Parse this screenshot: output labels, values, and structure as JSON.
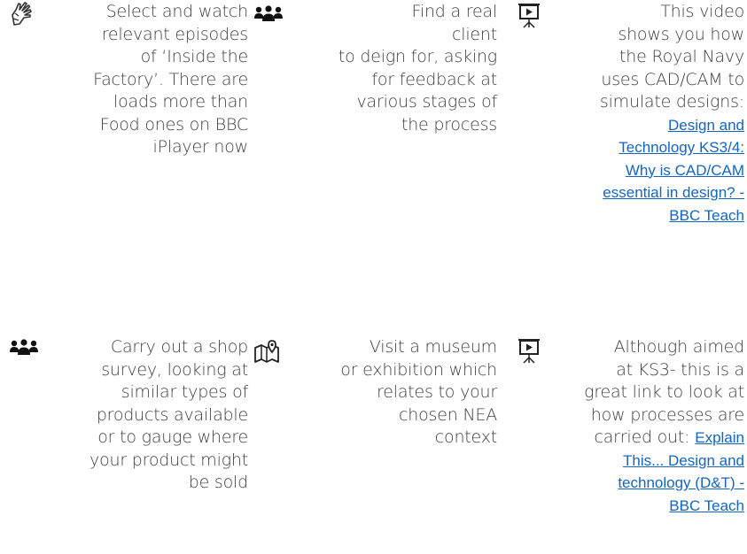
{
  "cells": [
    {
      "icon": "sign-language-hand-icon",
      "lines": [
        "Select and watch",
        "relevant episodes",
        "of ‘Inside the",
        "Factory’. There are",
        "loads more than",
        "Food ones on BBC",
        "iPlayer now"
      ]
    },
    {
      "icon": "people-group-icon",
      "lines": [
        "Find a real",
        "client",
        "to deign for, asking",
        "for feedback at",
        "various stages of",
        "the process"
      ]
    },
    {
      "icon": "presentation-board-icon",
      "lines": [
        "This video",
        "shows you how",
        "the Royal Navy",
        "uses CAD/CAM to",
        "simulate designs:"
      ],
      "link_lines": [
        "Design and",
        "Technology KS3/4:",
        "Why is CAD/CAM",
        "essential in design? -",
        "BBC Teach"
      ]
    },
    {
      "icon": "people-group-icon",
      "lines": [
        "Carry out a shop",
        "survey, looking at",
        "similar types of",
        "products available",
        "or to gauge where",
        "your product might",
        "be sold"
      ]
    },
    {
      "icon": "map-location-icon",
      "lines": [
        "Visit a museum",
        "or exhibition which",
        "relates to your",
        "chosen NEA",
        "context"
      ]
    },
    {
      "icon": "presentation-board-icon",
      "lines": [
        "Although aimed",
        "at KS3- this is a",
        "great link to look at",
        "how processes are"
      ],
      "mixed_line": {
        "text": "carried out:",
        "link": "Explain"
      },
      "link_lines": [
        "This... Design and",
        "technology (D&T) -",
        "BBC Teach"
      ]
    }
  ]
}
